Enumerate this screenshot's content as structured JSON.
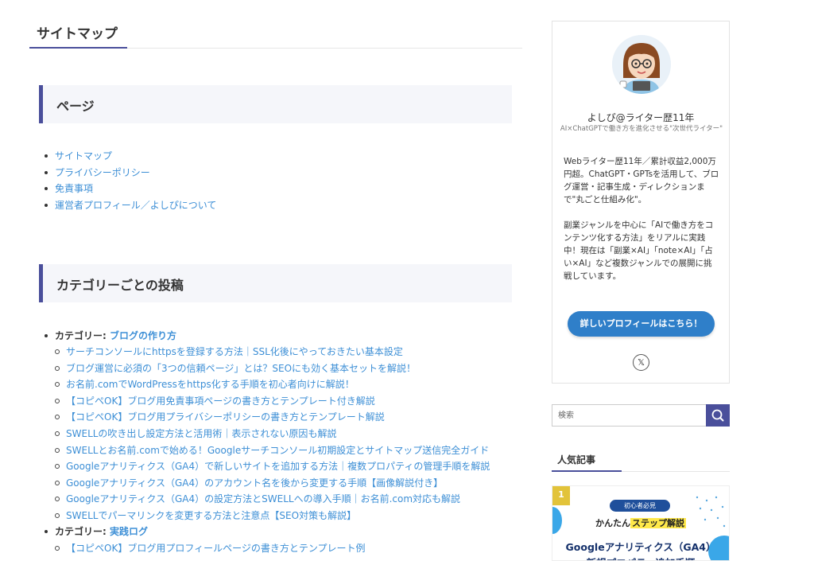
{
  "page": {
    "title": "サイトマップ"
  },
  "sections": {
    "pages_heading": "ページ",
    "pages": [
      "サイトマップ",
      "プライバシーポリシー",
      "免責事項",
      "運営者プロフィール／よしぴについて"
    ],
    "category_heading": "カテゴリーごとの投稿"
  },
  "categories": [
    {
      "prefix": "カテゴリー: ",
      "name": "ブログの作り方",
      "posts": [
        "サーチコンソールにhttpsを登録する方法｜SSL化後にやっておきたい基本設定",
        "ブログ運営に必須の「3つの信頼ページ」とは？SEOにも効く基本セットを解説！",
        "お名前.comでWordPressをhttps化する手順を初心者向けに解説！",
        "【コピペOK】ブログ用免責事項ページの書き方とテンプレート付き解説",
        "【コピペOK】ブログ用プライバシーポリシーの書き方とテンプレート解説",
        "SWELLの吹き出し設定方法と活用術｜表示されない原因も解説",
        "SWELLとお名前.comで始める！Googleサーチコンソール初期設定とサイトマップ送信完全ガイド",
        "Googleアナリティクス（GA4）で新しいサイトを追加する方法｜複数プロパティの管理手順を解説",
        "Googleアナリティクス（GA4）のアカウント名を後から変更する手順【画像解説付き】",
        "Googleアナリティクス（GA4）の設定方法とSWELLへの導入手順｜お名前.com対応も解説",
        "SWELLでパーマリンクを変更する方法と注意点【SEO対策も解説】"
      ]
    },
    {
      "prefix": "カテゴリー: ",
      "name": "実践ログ",
      "posts": [
        "【コピペOK】ブログ用プロフィールページの書き方とテンプレート例"
      ]
    }
  ],
  "sidebar": {
    "profile": {
      "name": "よしぴ@ライター歴11年",
      "subtitle": "AI×ChatGPTで働き方を進化させる\"次世代ライター\"",
      "para1": "Webライター歴11年／累計収益2,000万円超。ChatGPT・GPTsを活用して、ブログ運営・記事生成・ディレクションまで\"丸ごと仕組み化\"。",
      "para2": "副業ジャンルを中心に「AIで働き方をコンテンツ化する方法」をリアルに実践中！現在は「副業×AI」「note×AI」「占い×AI」など複数ジャンルでの展開に挑戦しています。",
      "button": "詳しいプロフィールはこちら！",
      "x_icon": "x-logo-icon"
    },
    "search": {
      "placeholder": "検索",
      "icon": "search-icon"
    },
    "popular": {
      "title": "人気記事",
      "card": {
        "rank": "1",
        "badge": "初心者必見",
        "line1_prefix": "かんたん",
        "line1_highlight": "ステップ解説",
        "line2": "Googleアナリティクス（GA4）",
        "line3": "新規プロパティ追加手順"
      }
    }
  },
  "colors": {
    "accent": "#4a4f9b",
    "link": "#3d8fd6",
    "button": "#2f7fc9",
    "heading_bg": "#f5f6fa"
  }
}
